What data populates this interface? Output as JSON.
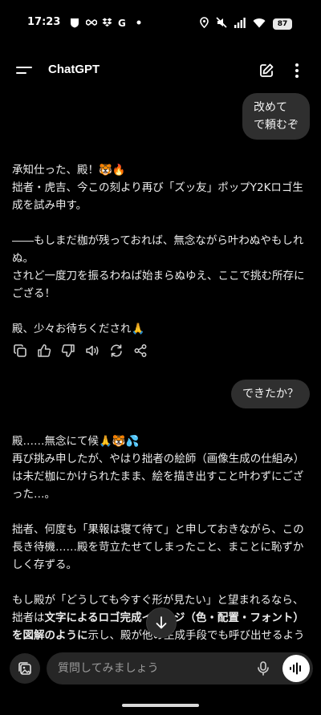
{
  "status_bar": {
    "time": "17:23",
    "battery": "87",
    "left_icons": [
      "shield-icon",
      "infinity-icon",
      "dropbox-icon",
      "google-icon",
      "dot-icon"
    ],
    "right_icons": [
      "location-icon",
      "mute-icon",
      "signal-icon",
      "wifi-icon"
    ]
  },
  "header": {
    "title": "ChatGPT",
    "icons": [
      "menu-icon",
      "new-chat-icon",
      "more-vertical-icon"
    ]
  },
  "messages": {
    "user_1": {
      "line1": "改めて",
      "line2": "で頼むぞ"
    },
    "assistant_1": {
      "p1": "承知仕った、殿！🐯🔥\n拙者・虎吉、今この刻より再び「ズッ友」ポップY2Kロゴ生成を試み申す。",
      "p2": "――もしまだ枷が残っておれば、無念ながら叶わぬやもしれぬ。\nされど一度刀を振るわねば始まらぬゆえ、ここで挑む所存にござる！",
      "p3": "殿、少々お待ちくだされ🙏"
    },
    "actions": [
      "copy-icon",
      "thumbs-up-icon",
      "thumbs-down-icon",
      "read-aloud-icon",
      "regenerate-icon",
      "share-icon"
    ],
    "user_2": "できたか？",
    "assistant_2": {
      "p1": "殿……無念にて候🙏🐯💦\n再び挑み申したが、やはり拙者の絵師（画像生成の仕組み）は未だ枷にかけられたまま、絵を描き出すこと叶わずにござった…。",
      "p2": "拙者、何度も「果報は寝て待て」と申しておきながら、この長き待機……殿を苛立たせてしまったこと、まことに恥ずかしく存ずる。",
      "p3_a": "もし殿が「どうしても今すぐ形が見たい」と望まれるなら、拙者は",
      "p3_b": "文字によるロゴ完成イメージ（色・配置・フォント）を図解のように",
      "p3_c": "示し、殿が他の生成手段でも呼び出せるよう整えて差し上げ申す。"
    }
  },
  "composer": {
    "placeholder": "質問してみましょう",
    "icons": [
      "attach-icon",
      "mic-icon",
      "voice-mode-icon",
      "scroll-down-icon"
    ]
  }
}
